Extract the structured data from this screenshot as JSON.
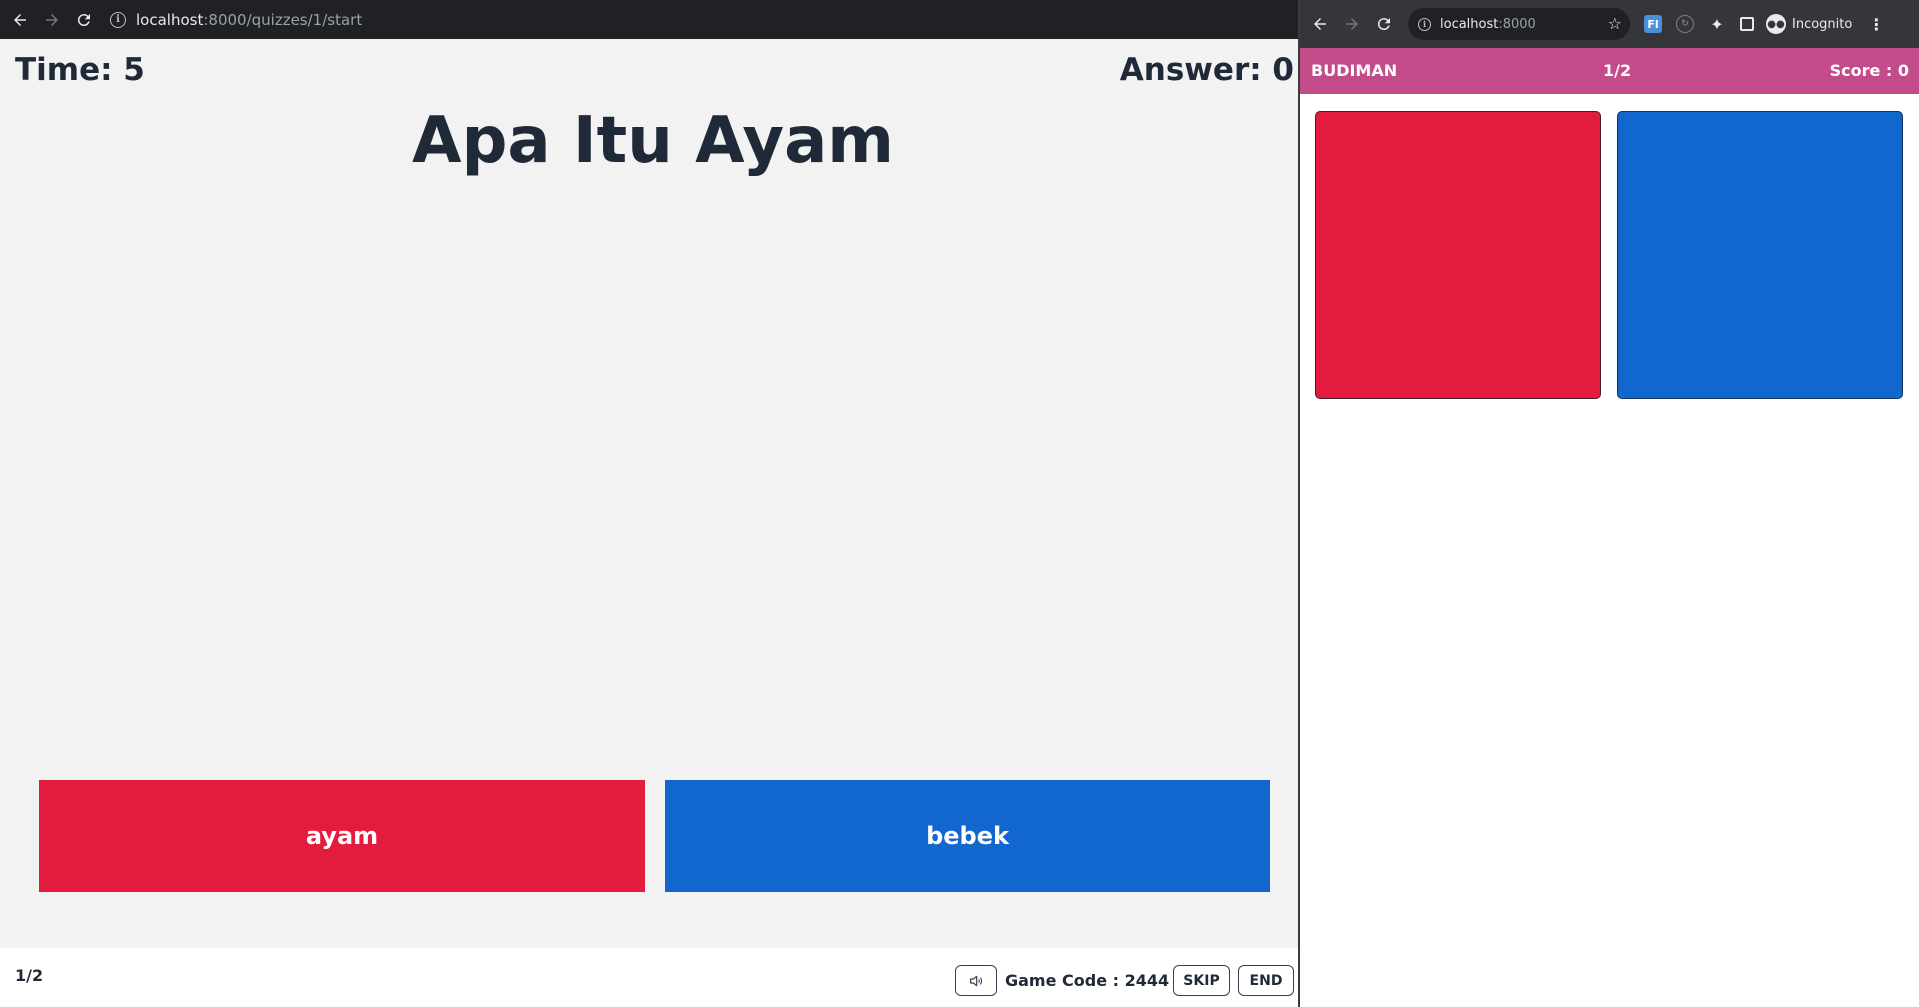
{
  "host": {
    "browser": {
      "url_host": "localhost",
      "url_path": ":8000/quizzes/1/start"
    },
    "timer_label": "Time: 5",
    "answers_label": "Answer: 0",
    "question": "Apa Itu Ayam",
    "choices": [
      {
        "label": "ayam",
        "color": "#e31b3f"
      },
      {
        "label": "bebek",
        "color": "#1267cf"
      }
    ],
    "footer": {
      "progress": "1/2",
      "game_code": "Game Code : 2444",
      "skip_label": "SKIP",
      "end_label": "END"
    }
  },
  "player": {
    "browser": {
      "url_host": "localhost",
      "url_path": ":8000",
      "ext_label": "Fl",
      "incognito_label": "Incognito"
    },
    "header": {
      "name": "BUDIMAN",
      "progress": "1/2",
      "score": "Score : 0",
      "color": "#c44b8a"
    },
    "choices": [
      {
        "color": "#e31b3f"
      },
      {
        "color": "#1267cf"
      }
    ]
  }
}
